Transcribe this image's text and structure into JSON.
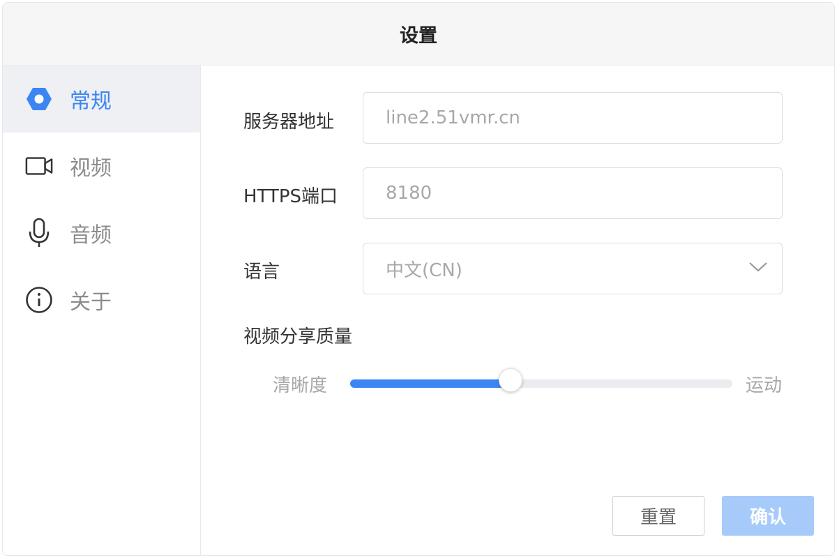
{
  "dialog": {
    "title": "设置"
  },
  "sidebar": {
    "items": [
      {
        "label": "常规",
        "icon": "hexagon-settings-icon",
        "active": true
      },
      {
        "label": "视频",
        "icon": "video-camera-icon",
        "active": false
      },
      {
        "label": "音频",
        "icon": "microphone-icon",
        "active": false
      },
      {
        "label": "关于",
        "icon": "info-icon",
        "active": false
      }
    ]
  },
  "form": {
    "server": {
      "label": "服务器地址",
      "value": "line2.51vmr.cn"
    },
    "port": {
      "label": "HTTPS端口",
      "value": "8180"
    },
    "language": {
      "label": "语言",
      "value": "中文(CN)"
    },
    "quality": {
      "label": "视频分享质量",
      "left_label": "清晰度",
      "right_label": "运动",
      "value_fraction": 0.42
    }
  },
  "buttons": {
    "reset": "重置",
    "confirm": "确认"
  },
  "colors": {
    "accent": "#3b86f3",
    "confirm_disabled": "#a6cbfa"
  }
}
